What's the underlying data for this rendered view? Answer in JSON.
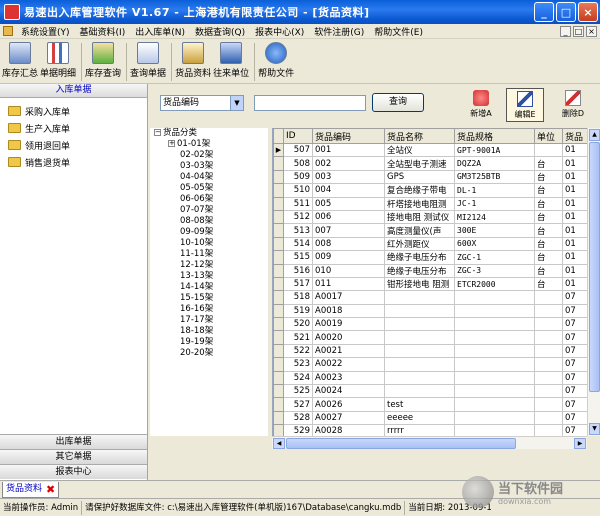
{
  "window": {
    "title": "易速出入库管理软件 V1.67 - 上海港机有限责任公司 - [货品资料]",
    "controls": {
      "minimize": "_",
      "maximize": "□",
      "close": "×"
    }
  },
  "menubar": {
    "items": [
      "系统设置(Y)",
      "基础资料(I)",
      "出入库单(N)",
      "数据查询(Q)",
      "报表中心(X)",
      "软件注册(G)",
      "帮助文件(E)"
    ],
    "mdi": [
      "_",
      "□",
      "×"
    ]
  },
  "toolbar": {
    "buttons": [
      {
        "label": "库存汇总",
        "icon": "stock-summary-icon",
        "color": "#6a8cc8"
      },
      {
        "label": "单据明细",
        "icon": "chart-icon",
        "color": "#d44040"
      },
      {
        "label": "库存查询",
        "icon": "warehouse-query-icon",
        "color": "#5cb040"
      },
      {
        "label": "查询单据",
        "icon": "document-search-icon",
        "color": "#5070c0"
      },
      {
        "label": "货品资料",
        "icon": "goods-icon",
        "color": "#c8a040"
      },
      {
        "label": "往来单位",
        "icon": "contacts-icon",
        "color": "#3060b0"
      },
      {
        "label": "帮助文件",
        "icon": "help-icon",
        "color": "#2060c0"
      }
    ]
  },
  "leftpanel": {
    "header": "入库单据",
    "items": [
      "采购入库单",
      "生产入库单",
      "领用退回单",
      "销售退货单"
    ],
    "bottom": [
      "出库单据",
      "其它单据",
      "报表中心"
    ]
  },
  "search": {
    "field_selected": "货品编码",
    "value": "",
    "button": "查询"
  },
  "actions": [
    {
      "label": "新增A",
      "icon": "add-icon",
      "color": "#d03030"
    },
    {
      "label": "编辑E",
      "icon": "edit-icon",
      "color": "#3050a0"
    },
    {
      "label": "删除D",
      "icon": "delete-icon",
      "color": "#d03030"
    }
  ],
  "tree": {
    "root": "货品分类",
    "children": [
      "01-01架",
      "02-02架",
      "03-03架",
      "04-04架",
      "05-05架",
      "06-06架",
      "07-07架",
      "08-08架",
      "09-09架",
      "10-10架",
      "11-11架",
      "12-12架",
      "13-13架",
      "14-14架",
      "15-15架",
      "16-16架",
      "17-17架",
      "18-18架",
      "19-19架",
      "20-20架"
    ]
  },
  "grid": {
    "columns": [
      "ID",
      "货品编码",
      "货品名称",
      "货品规格",
      "单位",
      "货品"
    ],
    "rows": [
      [
        "507",
        "001",
        "全站仪",
        "GPT-9001A",
        "",
        "01"
      ],
      [
        "508",
        "002",
        "全站型电子测速",
        "DQZ2A",
        "台",
        "01"
      ],
      [
        "509",
        "003",
        "GPS",
        "GM3T25BTB",
        "台",
        "01"
      ],
      [
        "510",
        "004",
        "复合绝缘子带电",
        "DL-1",
        "台",
        "01"
      ],
      [
        "511",
        "005",
        "杆塔接地电阻测",
        "JC-1",
        "台",
        "01"
      ],
      [
        "512",
        "006",
        "接地电阻 测试仪",
        "MI2124",
        "台",
        "01"
      ],
      [
        "513",
        "007",
        "高度测量仪(声",
        "300E",
        "台",
        "01"
      ],
      [
        "514",
        "008",
        "红外测距仪",
        "600X",
        "台",
        "01"
      ],
      [
        "515",
        "009",
        "绝缘子电压分布",
        "ZGC-1",
        "台",
        "01"
      ],
      [
        "516",
        "010",
        "绝缘子电压分布",
        "ZGC-3",
        "台",
        "01"
      ],
      [
        "517",
        "011",
        "钳形接地电 阻测",
        "ETCR2000",
        "台",
        "01"
      ],
      [
        "518",
        "A0017",
        "",
        "",
        "",
        "07"
      ],
      [
        "519",
        "A0018",
        "",
        "",
        "",
        "07"
      ],
      [
        "520",
        "A0019",
        "",
        "",
        "",
        "07"
      ],
      [
        "521",
        "A0020",
        "",
        "",
        "",
        "07"
      ],
      [
        "522",
        "A0021",
        "",
        "",
        "",
        "07"
      ],
      [
        "523",
        "A0022",
        "",
        "",
        "",
        "07"
      ],
      [
        "524",
        "A0023",
        "",
        "",
        "",
        "07"
      ],
      [
        "525",
        "A0024",
        "",
        "",
        "",
        "07"
      ],
      [
        "527",
        "A0026",
        "test",
        "",
        "",
        "07"
      ],
      [
        "528",
        "A0027",
        "eeeee",
        "",
        "",
        "07"
      ],
      [
        "529",
        "A0028",
        "rrrrr",
        "",
        "",
        "07"
      ]
    ],
    "selected_row": 0,
    "row_indicator": "▶"
  },
  "tabs": [
    {
      "label": "货品资料",
      "close": "✖"
    }
  ],
  "status": {
    "operator": "当前操作员: Admin",
    "db": "请保护好数据库文件: c:\\易速出入库管理软件(单机版)167\\Database\\cangku.mdb",
    "date": "当前日期: 2013-09-1"
  },
  "watermark": {
    "cn": "当下软件园",
    "en": "downxia.com"
  }
}
